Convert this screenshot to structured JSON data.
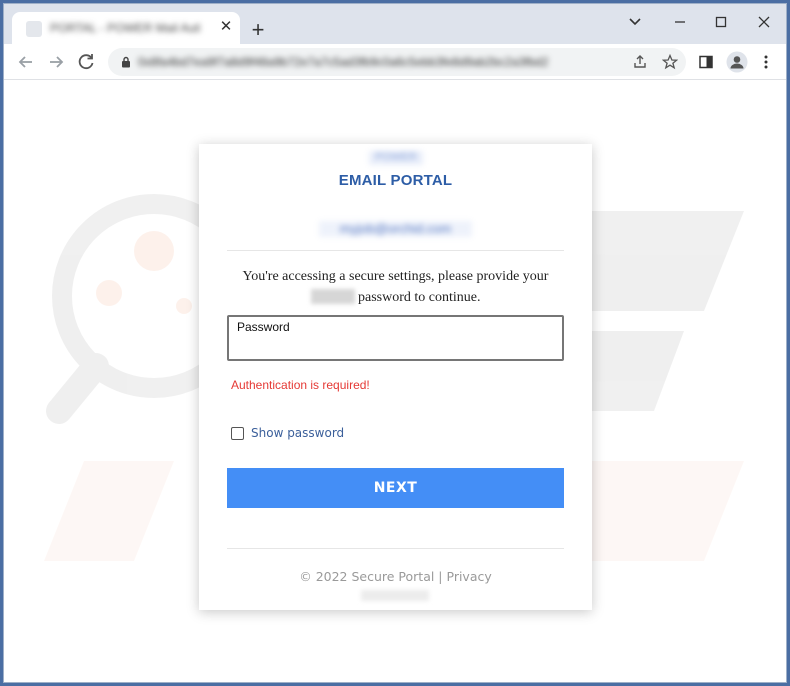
{
  "browser": {
    "tab_title": "PORTAL - POWER Mail Authentication",
    "tab_close": "✕",
    "new_tab": "+",
    "url": "0x8fa4bd7ea9f7a8d9f48a9b72e7a7c5ad3fb9c0a6c5ebb3fe8d9ab2bc2a3fbd2",
    "icons": [
      "back-icon",
      "forward-icon",
      "reload-icon",
      "lock-icon",
      "share-icon",
      "star-icon",
      "sidepanel-icon",
      "profile-icon",
      "menu-icon",
      "minimize-icon",
      "maximize-icon",
      "close-icon"
    ]
  },
  "card": {
    "logo_text": "POWER",
    "title": "EMAIL PORTAL",
    "email": "myjob@orchid.com",
    "message_before": "You're accessing a secure settings, please provide your",
    "message_blurred": "orchid",
    "message_after": "password to continue.",
    "password_label": "Password",
    "password_value": "",
    "error": "Authentication is required!",
    "show_password_label": "Show password",
    "show_password_checked": false,
    "next_label": "NEXT",
    "footer": "© 2022 Secure Portal | Privacy",
    "footer_blurred": "orchid"
  },
  "colors": {
    "accent": "#448ef6",
    "title": "#2d5da6",
    "error": "#e53935",
    "link": "#3b5f9a",
    "page_border": "#4b6ea3"
  }
}
